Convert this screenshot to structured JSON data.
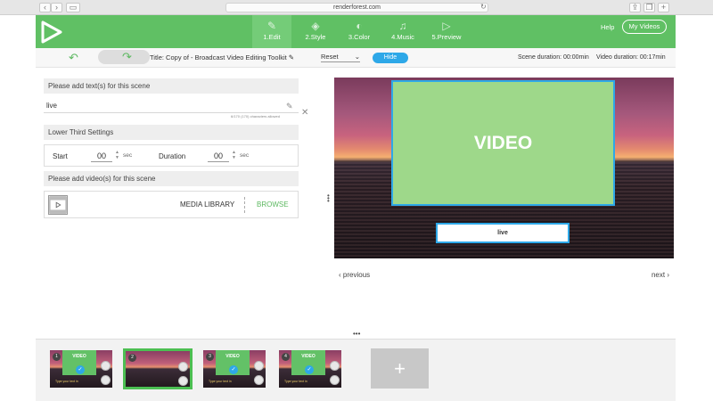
{
  "browser": {
    "url": "renderforest.com"
  },
  "header": {
    "steps": [
      {
        "label": "1.Edit",
        "icon": "pencil-icon",
        "active": true
      },
      {
        "label": "2.Style",
        "icon": "layers-icon",
        "active": false
      },
      {
        "label": "3.Color",
        "icon": "palette-icon",
        "active": false
      },
      {
        "label": "4.Music",
        "icon": "music-icon",
        "active": false
      },
      {
        "label": "5.Preview",
        "icon": "play-icon",
        "active": false
      }
    ],
    "help_label": "Help",
    "my_videos_label": "My Videos",
    "brand_color": "#60c064"
  },
  "toolbar": {
    "title": "Title: Copy of - Broadcast Video Editing Toolkit",
    "reset_label": "Reset",
    "hide_label": "Hide",
    "scene_duration": "Scene duration: 00:00min",
    "video_duration": "Video duration: 00:17min"
  },
  "text_section": {
    "header": "Please add text(s) for this scene",
    "value": "live",
    "char_count": "6/170 (170) characters allowed"
  },
  "lower_third": {
    "header": "Lower Third Settings",
    "start_label": "Start",
    "start_value": "00",
    "duration_label": "Duration",
    "duration_value": "00",
    "unit": "sec"
  },
  "video_section": {
    "header": "Please add video(s) for this scene",
    "media_library_label": "MEDIA LIBRARY",
    "browse_label": "BROWSE"
  },
  "preview": {
    "video_label": "VIDEO",
    "caption": "live",
    "prev_label": "previous",
    "next_label": "next"
  },
  "timeline": {
    "thumbs": [
      {
        "num": "1",
        "label": "VIDEO",
        "sub": "Type your text in"
      },
      {
        "num": "2",
        "label": "",
        "sub": ""
      },
      {
        "num": "3",
        "label": "VIDEO",
        "sub": "Type your text in"
      },
      {
        "num": "4",
        "label": "VIDEO",
        "sub": "Type your text in"
      }
    ],
    "add_label": "+"
  }
}
